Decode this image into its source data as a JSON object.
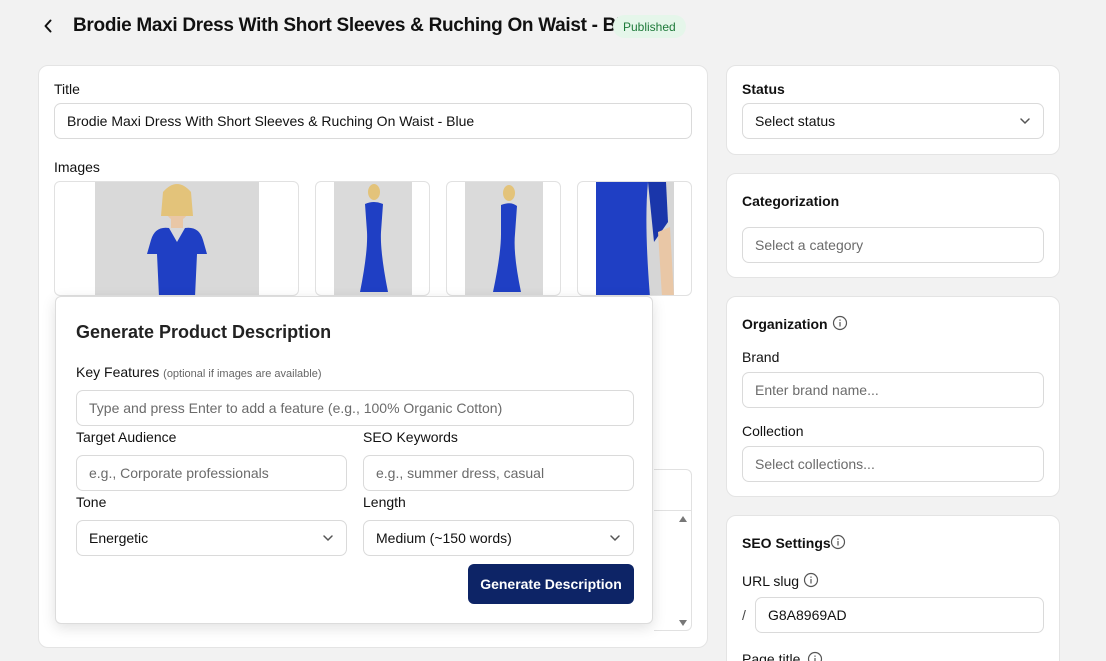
{
  "header": {
    "title": "Brodie Maxi Dress With Short Sleeves & Ruching On Waist - Blue",
    "status_badge": "Published"
  },
  "main": {
    "title_label": "Title",
    "title_value": "Brodie Maxi Dress With Short Sleeves & Ruching On Waist - Blue",
    "images_label": "Images"
  },
  "modal": {
    "title": "Generate Product Description",
    "key_features_label": "Key Features",
    "key_features_hint": "(optional if images are available)",
    "key_features_placeholder": "Type and press Enter to add a feature (e.g., 100% Organic Cotton)",
    "target_audience_label": "Target Audience",
    "target_audience_placeholder": "e.g., Corporate professionals",
    "seo_keywords_label": "SEO Keywords",
    "seo_keywords_placeholder": "e.g., summer dress, casual",
    "tone_label": "Tone",
    "tone_value": "Energetic",
    "length_label": "Length",
    "length_value": "Medium (~150 words)",
    "generate_button": "Generate Description"
  },
  "sidebar": {
    "status": {
      "label": "Status",
      "select_value": "Select status"
    },
    "categorization": {
      "label": "Categorization",
      "placeholder": "Select a category"
    },
    "organization": {
      "label": "Organization",
      "brand_label": "Brand",
      "brand_placeholder": "Enter brand name...",
      "collection_label": "Collection",
      "collection_placeholder": "Select collections..."
    },
    "seo": {
      "label": "SEO Settings",
      "url_slug_label": "URL slug",
      "slug_prefix": "/",
      "slug_value": "G8A8969AD",
      "page_title_label": "Page title"
    }
  },
  "colors": {
    "primary_button": "#0d2466",
    "dress_blue": "#1f3fc4",
    "badge_bg": "#e5f6ea",
    "badge_text": "#1e7a3a"
  }
}
